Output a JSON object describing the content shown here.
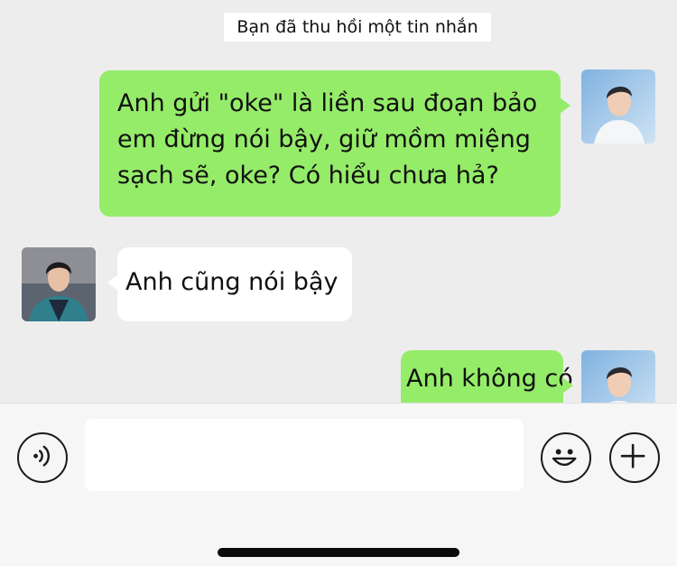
{
  "chat": {
    "system_notice": "Bạn đã thu hồi một tin nhắn",
    "messages": [
      {
        "side": "outgoing",
        "lines": [
          "Anh gửi \"oke\" là liền sau đoạn bảo",
          "em đừng nói bậy, giữ mồm miệng",
          "sạch sẽ, oke? Có hiểu chưa hả?"
        ]
      },
      {
        "side": "incoming",
        "text": "Anh cũng nói bậy"
      },
      {
        "side": "outgoing",
        "text": "Anh không có"
      }
    ]
  },
  "input_bar": {
    "placeholder": "",
    "voice_icon": "voice-icon",
    "emoji_icon": "emoji-icon",
    "plus_icon": "plus-icon"
  },
  "colors": {
    "outgoing_bubble": "#95ec69",
    "incoming_bubble": "#ffffff",
    "background": "#ededed"
  }
}
